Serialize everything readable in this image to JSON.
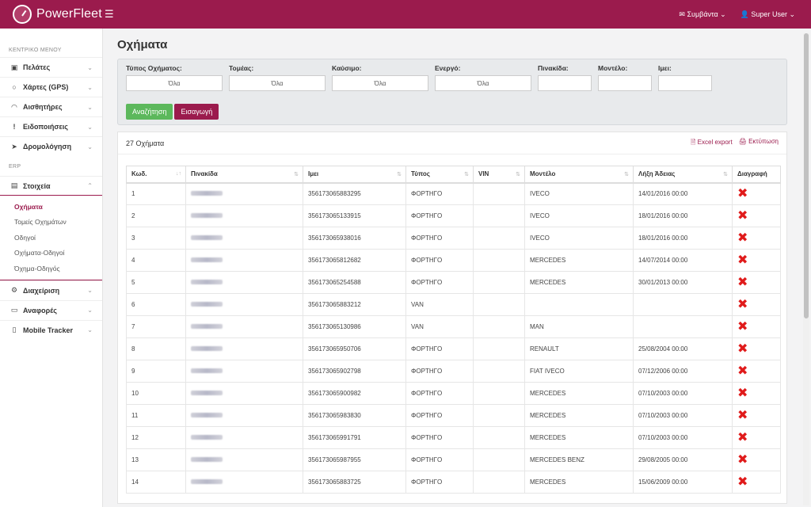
{
  "app": {
    "name": "PowerFleet",
    "top_right": {
      "events": "Συμβάντα",
      "user": "Super User"
    }
  },
  "sidebar": {
    "section_main": "ΚΕΝΤΡΙΚΟ ΜΕΝΟΥ",
    "main_items": [
      {
        "label": "Πελάτες",
        "icon": "map-icon"
      },
      {
        "label": "Χάρτες (GPS)",
        "icon": "circle-icon"
      },
      {
        "label": "Αισθητήρες",
        "icon": "gauge-icon"
      },
      {
        "label": "Ειδοποιήσεις",
        "icon": "exclamation-icon"
      },
      {
        "label": "Δρομολόγηση",
        "icon": "send-icon"
      }
    ],
    "section_erp": "ERP",
    "erp_open": {
      "label": "Στοιχεία",
      "icon": "truck-icon"
    },
    "sub_items": [
      "Οχήματα",
      "Τομείς Οχημάτων",
      "Οδηγοί",
      "Οχήματα-Οδηγοί",
      "Όχημα-Οδηγός"
    ],
    "bottom_items": [
      {
        "label": "Διαχείριση",
        "icon": "gear-icon"
      },
      {
        "label": "Αναφορές",
        "icon": "monitor-icon"
      },
      {
        "label": "Mobile Tracker",
        "icon": "mobile-icon"
      }
    ]
  },
  "page": {
    "title": "Οχήματα"
  },
  "filters": {
    "type": {
      "label": "Τύπος Οχήματος:",
      "value": "Όλα"
    },
    "sector": {
      "label": "Τομέας:",
      "value": "Όλα"
    },
    "fuel": {
      "label": "Καύσιμο:",
      "value": "Όλα"
    },
    "active": {
      "label": "Ενεργό:",
      "value": "Όλα"
    },
    "plate": {
      "label": "Πινακίδα:",
      "value": ""
    },
    "model": {
      "label": "Μοντέλο:",
      "value": ""
    },
    "imei": {
      "label": "Ιμει:",
      "value": ""
    },
    "search_btn": "Αναζήτηση",
    "insert_btn": "Εισαγωγή"
  },
  "panel": {
    "count": "27 Οχήματα",
    "excel": "Excel export",
    "print": "Εκτύπωση"
  },
  "table": {
    "headers": [
      "Κωδ.",
      "Πινακίδα",
      "Ιμει",
      "Τύπος",
      "VIN",
      "Μοντέλο",
      "Λήξη Άδειας",
      "Διαγραφή"
    ],
    "rows": [
      [
        "1",
        "",
        "356173065883295",
        "ΦΟΡΤΗΓΟ",
        "",
        "IVECO",
        "14/01/2016 00:00"
      ],
      [
        "2",
        "",
        "356173065133915",
        "ΦΟΡΤΗΓΟ",
        "",
        "IVECO",
        "18/01/2016 00:00"
      ],
      [
        "3",
        "",
        "356173065938016",
        "ΦΟΡΤΗΓΟ",
        "",
        "IVECO",
        "18/01/2016 00:00"
      ],
      [
        "4",
        "",
        "356173065812682",
        "ΦΟΡΤΗΓΟ",
        "",
        "MERCEDES",
        "14/07/2014 00:00"
      ],
      [
        "5",
        "",
        "356173065254588",
        "ΦΟΡΤΗΓΟ",
        "",
        "MERCEDES",
        "30/01/2013 00:00"
      ],
      [
        "6",
        "",
        "356173065883212",
        "VAN",
        "",
        "",
        ""
      ],
      [
        "7",
        "",
        "356173065130986",
        "VAN",
        "",
        "MAN",
        ""
      ],
      [
        "8",
        "",
        "356173065950706",
        "ΦΟΡΤΗΓΟ",
        "",
        "RENAULT",
        "25/08/2004 00:00"
      ],
      [
        "9",
        "",
        "356173065902798",
        "ΦΟΡΤΗΓΟ",
        "",
        "FIAT IVECO",
        "07/12/2006 00:00"
      ],
      [
        "10",
        "",
        "356173065900982",
        "ΦΟΡΤΗΓΟ",
        "",
        "MERCEDES",
        "07/10/2003 00:00"
      ],
      [
        "11",
        "",
        "356173065983830",
        "ΦΟΡΤΗΓΟ",
        "",
        "MERCEDES",
        "07/10/2003 00:00"
      ],
      [
        "12",
        "",
        "356173065991791",
        "ΦΟΡΤΗΓΟ",
        "",
        "MERCEDES",
        "07/10/2003 00:00"
      ],
      [
        "13",
        "",
        "356173065987955",
        "ΦΟΡΤΗΓΟ",
        "",
        "MERCEDES BENZ",
        "29/08/2005 00:00"
      ],
      [
        "14",
        "",
        "356173065883725",
        "ΦΟΡΤΗΓΟ",
        "",
        "MERCEDES",
        "15/06/2009 00:00"
      ]
    ]
  }
}
